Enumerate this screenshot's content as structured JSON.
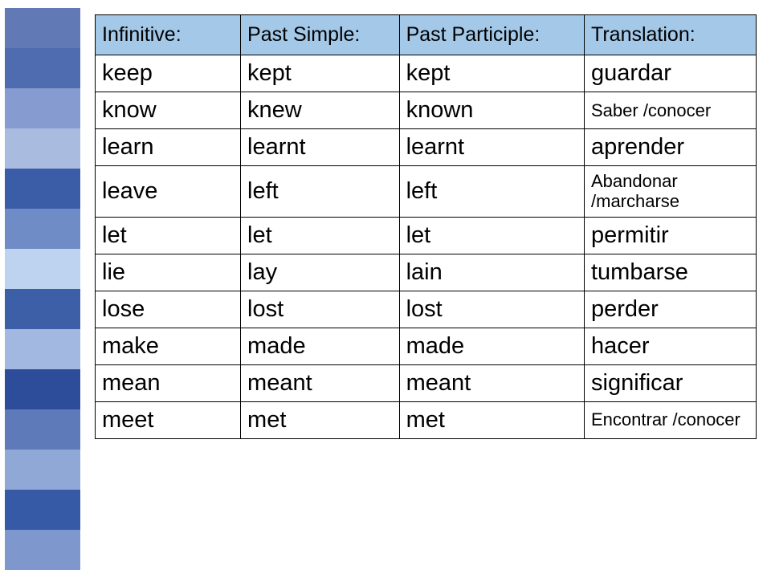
{
  "headers": {
    "infinitive": "Infinitive:",
    "past_simple": "Past Simple:",
    "past_participle": "Past Participle:",
    "translation": "Translation:"
  },
  "rows": [
    {
      "infinitive": "keep",
      "past_simple": "kept",
      "past_participle": "kept",
      "translation": "guardar",
      "translation_small": false
    },
    {
      "infinitive": "know",
      "past_simple": "knew",
      "past_participle": "known",
      "translation": "Saber /conocer",
      "translation_small": true
    },
    {
      "infinitive": "learn",
      "past_simple": "learnt",
      "past_participle": "learnt",
      "translation": "aprender",
      "translation_small": false
    },
    {
      "infinitive": "leave",
      "past_simple": "left",
      "past_participle": "left",
      "translation": "Abandonar /marcharse",
      "translation_small": true
    },
    {
      "infinitive": "let",
      "past_simple": "let",
      "past_participle": "let",
      "translation": "permitir",
      "translation_small": false
    },
    {
      "infinitive": "lie",
      "past_simple": "lay",
      "past_participle": "lain",
      "translation": "tumbarse",
      "translation_small": false
    },
    {
      "infinitive": "lose",
      "past_simple": "lost",
      "past_participle": "lost",
      "translation": "perder",
      "translation_small": false
    },
    {
      "infinitive": "make",
      "past_simple": "made",
      "past_participle": "made",
      "translation": "hacer",
      "translation_small": false
    },
    {
      "infinitive": "mean",
      "past_simple": "meant",
      "past_participle": "meant",
      "translation": "significar",
      "translation_small": false
    },
    {
      "infinitive": "meet",
      "past_simple": "met",
      "past_participle": "met",
      "translation": "Encontrar /conocer",
      "translation_small": true
    }
  ],
  "chart_data": {
    "type": "table",
    "title": "Irregular Verbs — Infinitive / Past Simple / Past Participle / Spanish Translation",
    "columns": [
      "Infinitive",
      "Past Simple",
      "Past Participle",
      "Translation"
    ],
    "rows": [
      [
        "keep",
        "kept",
        "kept",
        "guardar"
      ],
      [
        "know",
        "knew",
        "known",
        "Saber /conocer"
      ],
      [
        "learn",
        "learnt",
        "learnt",
        "aprender"
      ],
      [
        "leave",
        "left",
        "left",
        "Abandonar /marcharse"
      ],
      [
        "let",
        "let",
        "let",
        "permitir"
      ],
      [
        "lie",
        "lay",
        "lain",
        "tumbarse"
      ],
      [
        "lose",
        "lost",
        "lost",
        "perder"
      ],
      [
        "make",
        "made",
        "made",
        "hacer"
      ],
      [
        "mean",
        "meant",
        "meant",
        "significar"
      ],
      [
        "meet",
        "met",
        "met",
        "Encontrar /conocer"
      ]
    ]
  }
}
